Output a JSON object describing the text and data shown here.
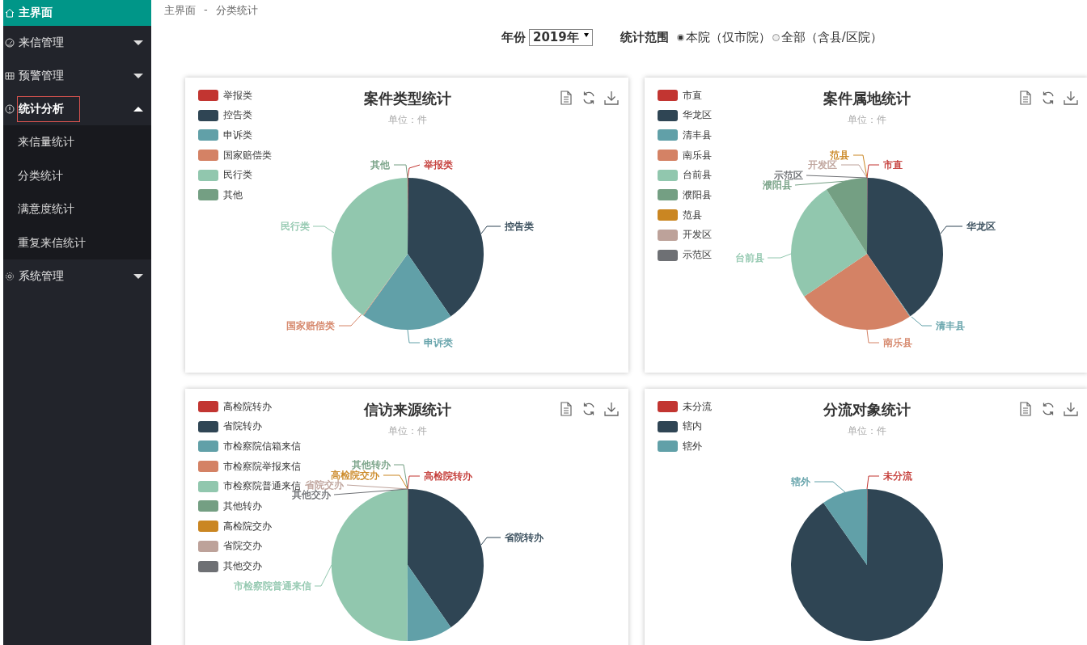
{
  "sidebar": {
    "items": [
      {
        "label": "主界面",
        "selected": true,
        "outlined": false
      },
      {
        "label": "来信管理",
        "selected": false,
        "outlined": false,
        "expanded": false
      },
      {
        "label": "预警管理",
        "selected": false,
        "outlined": false,
        "expanded": false
      },
      {
        "label": "统计分析",
        "selected": false,
        "outlined": true,
        "expanded": true,
        "children": [
          {
            "label": "来信量统计"
          },
          {
            "label": "分类统计"
          },
          {
            "label": "满意度统计"
          },
          {
            "label": "重复来信统计"
          }
        ]
      },
      {
        "label": "系统管理",
        "selected": false,
        "outlined": false,
        "expanded": false
      }
    ]
  },
  "breadcrumb": [
    "主界面",
    "-",
    "分类统计"
  ],
  "filters": {
    "year_label": "年份",
    "year_value": "2019年",
    "range_label": "统计范围",
    "range_options": [
      {
        "label": "本院（仅市院）",
        "selected": true
      },
      {
        "label": "全部（含县/区院）",
        "selected": false
      }
    ]
  },
  "charts": [
    {
      "title": "案件类型统计",
      "subtitle": "单位：件",
      "legend": [
        {
          "label": "举报类",
          "color": "#c23531"
        },
        {
          "label": "控告类",
          "color": "#2f4554"
        },
        {
          "label": "申诉类",
          "color": "#61a0a8"
        },
        {
          "label": "国家赔偿类",
          "color": "#d48265"
        },
        {
          "label": "民行类",
          "color": "#91c7ae"
        },
        {
          "label": "其他",
          "color": "#749f83"
        }
      ],
      "slice_labels": [
        {
          "label": "举报类",
          "color": "#c23531"
        },
        {
          "label": "其他",
          "color": "#749f83"
        },
        {
          "label": "控告类",
          "color": "#2f4554"
        },
        {
          "label": "国家赔偿类",
          "color": "#d48265"
        },
        {
          "label": "申诉类",
          "color": "#61a0a8"
        },
        {
          "label": "民行类",
          "color": "#91c7ae"
        }
      ]
    },
    {
      "title": "案件属地统计",
      "subtitle": "单位：件",
      "legend": [
        {
          "label": "市直",
          "color": "#c23531"
        },
        {
          "label": "华龙区",
          "color": "#2f4554"
        },
        {
          "label": "清丰县",
          "color": "#61a0a8"
        },
        {
          "label": "南乐县",
          "color": "#d48265"
        },
        {
          "label": "台前县",
          "color": "#91c7ae"
        },
        {
          "label": "濮阳县",
          "color": "#749f83"
        },
        {
          "label": "范县",
          "color": "#ca8622"
        },
        {
          "label": "开发区",
          "color": "#bda29a"
        },
        {
          "label": "示范区",
          "color": "#6e7074"
        }
      ],
      "slice_labels": [
        {
          "label": "范县",
          "color": "#ca8622"
        },
        {
          "label": "开发区",
          "color": "#bda29a"
        },
        {
          "label": "市直",
          "color": "#c23531"
        },
        {
          "label": "示范区",
          "color": "#6e7074"
        },
        {
          "label": "濮阳县",
          "color": "#749f83"
        },
        {
          "label": "华龙区",
          "color": "#2f4554"
        },
        {
          "label": "台前县",
          "color": "#91c7ae"
        },
        {
          "label": "清丰县",
          "color": "#61a0a8"
        },
        {
          "label": "南乐县",
          "color": "#d48265"
        }
      ]
    },
    {
      "title": "信访来源统计",
      "subtitle": "单位：件",
      "legend": [
        {
          "label": "高检院转办",
          "color": "#c23531"
        },
        {
          "label": "省院转办",
          "color": "#2f4554"
        },
        {
          "label": "市检察院信箱来信",
          "color": "#61a0a8"
        },
        {
          "label": "市检察院举报来信",
          "color": "#d48265"
        },
        {
          "label": "市检察院普通来信",
          "color": "#91c7ae"
        },
        {
          "label": "其他转办",
          "color": "#749f83"
        },
        {
          "label": "高检院交办",
          "color": "#ca8622"
        },
        {
          "label": "省院交办",
          "color": "#bda29a"
        },
        {
          "label": "其他交办",
          "color": "#6e7074"
        }
      ],
      "slice_labels": [
        {
          "label": "其他转办",
          "color": "#749f83"
        },
        {
          "label": "高检院交办",
          "color": "#ca8622"
        },
        {
          "label": "高检院转办",
          "color": "#c23531"
        },
        {
          "label": "省院交办",
          "color": "#bda29a"
        },
        {
          "label": "其他交办",
          "color": "#6e7074"
        },
        {
          "label": "省院转办",
          "color": "#2f4554"
        },
        {
          "label": "市检察院普通来信",
          "color": "#91c7ae"
        }
      ]
    },
    {
      "title": "分流对象统计",
      "subtitle": "单位：件",
      "legend": [
        {
          "label": "未分流",
          "color": "#c23531"
        },
        {
          "label": "辖内",
          "color": "#2f4554"
        },
        {
          "label": "辖外",
          "color": "#61a0a8"
        }
      ],
      "slice_labels": [
        {
          "label": "辖外",
          "color": "#61a0a8"
        },
        {
          "label": "未分流",
          "color": "#c23531"
        }
      ]
    }
  ]
}
